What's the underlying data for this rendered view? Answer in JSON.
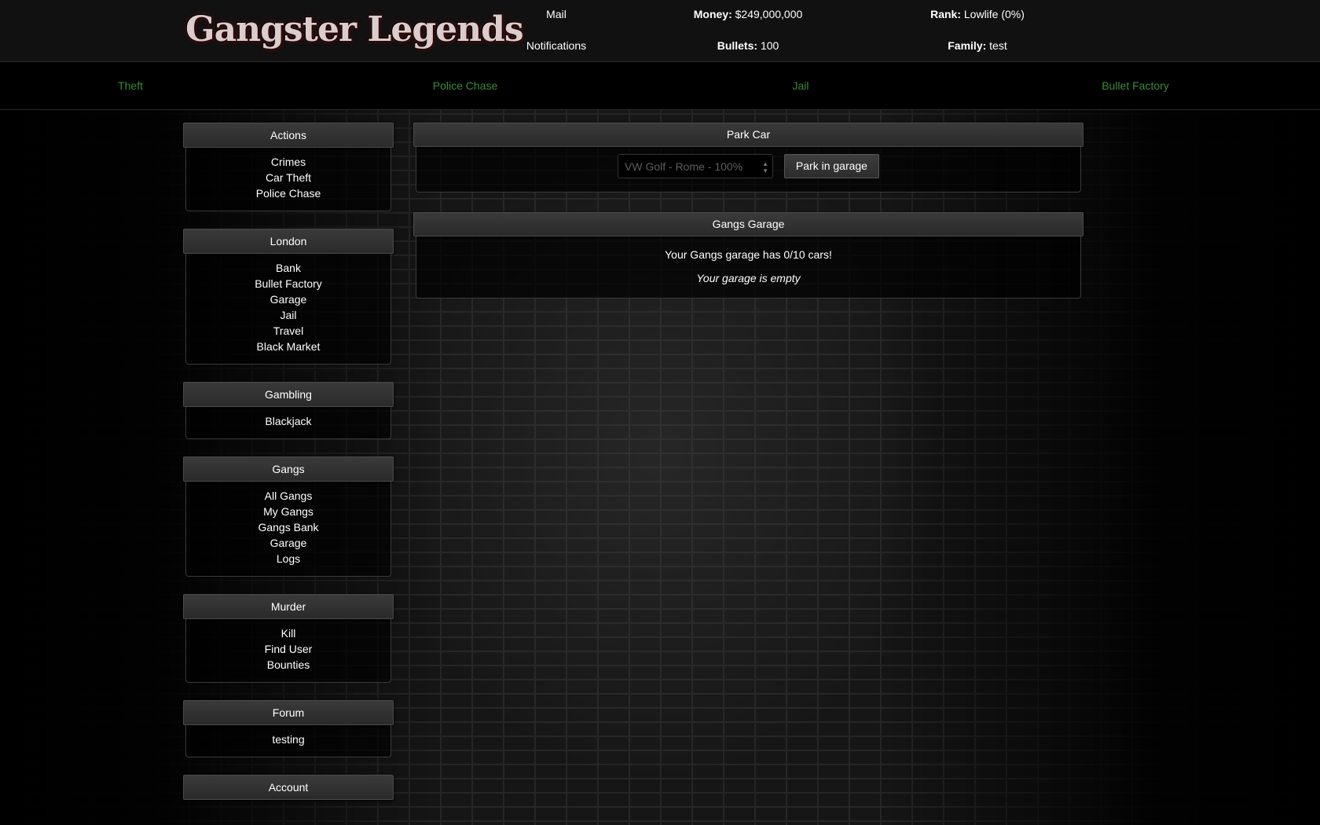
{
  "header": {
    "logo_text": "Gangster Legends",
    "mail": "Mail",
    "notifications": "Notifications",
    "money_label": "Money:",
    "money_value": "$249,000,000",
    "bullets_label": "Bullets:",
    "bullets_value": "100",
    "rank_label": "Rank:",
    "rank_value": "Lowlife (0%)",
    "family_label": "Family:",
    "family_value": "test"
  },
  "subnav": [
    "Theft",
    "Police Chase",
    "Jail",
    "Bullet Factory"
  ],
  "sidebar": [
    {
      "title": "Actions",
      "items": [
        "Crimes",
        "Car Theft",
        "Police Chase"
      ]
    },
    {
      "title": "London",
      "items": [
        "Bank",
        "Bullet Factory",
        "Garage",
        "Jail",
        "Travel",
        "Black Market"
      ]
    },
    {
      "title": "Gambling",
      "items": [
        "Blackjack"
      ]
    },
    {
      "title": "Gangs",
      "items": [
        "All Gangs",
        "My Gangs",
        "Gangs Bank",
        "Garage",
        "Logs"
      ]
    },
    {
      "title": "Murder",
      "items": [
        "Kill",
        "Find User",
        "Bounties"
      ]
    },
    {
      "title": "Forum",
      "items": [
        "testing"
      ]
    },
    {
      "title": "Account",
      "items": []
    }
  ],
  "park_car": {
    "title": "Park Car",
    "selected_car": "VW Golf - Rome - 100%",
    "button": "Park in garage"
  },
  "gangs_garage": {
    "title": "Gangs Garage",
    "capacity_text": "Your Gangs garage has 0/10 cars!",
    "empty_text": "Your garage is empty"
  }
}
